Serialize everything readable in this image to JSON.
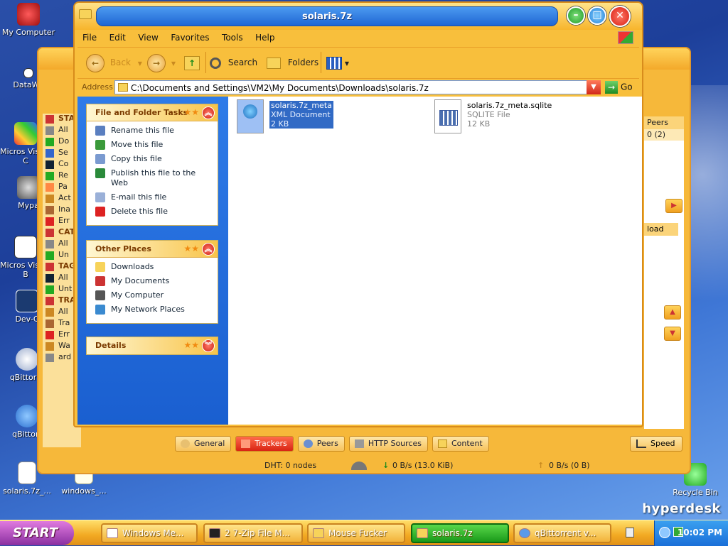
{
  "desktop": {
    "icons": [
      {
        "label": "My Computer"
      },
      {
        "label": "DataWa"
      },
      {
        "label": "Micros Visual C"
      },
      {
        "label": "Mypa"
      },
      {
        "label": "Micros Visual B"
      },
      {
        "label": "Dev-C"
      },
      {
        "label": "qBittorre"
      },
      {
        "label": "qBittorr"
      },
      {
        "label": "solaris.7z_..."
      },
      {
        "label": "windows_..."
      },
      {
        "label": "Recycle Bin"
      }
    ],
    "brand": "hyperdesk"
  },
  "qbittorrent": {
    "sidebar": [
      {
        "text": "STAT",
        "header": true
      },
      {
        "text": "All"
      },
      {
        "text": "Do"
      },
      {
        "text": "Se"
      },
      {
        "text": "Co"
      },
      {
        "text": "Re"
      },
      {
        "text": "Pa"
      },
      {
        "text": "Act"
      },
      {
        "text": "Ina"
      },
      {
        "text": "Err"
      },
      {
        "text": "CATE",
        "header": true
      },
      {
        "text": "All"
      },
      {
        "text": "Un"
      },
      {
        "text": "TAG",
        "header": true
      },
      {
        "text": "All"
      },
      {
        "text": "Unt"
      },
      {
        "text": "TRA",
        "header": true
      },
      {
        "text": "All"
      },
      {
        "text": "Tra"
      },
      {
        "text": "Err"
      },
      {
        "text": "Wa"
      },
      {
        "text": "ard"
      }
    ],
    "peers_header": "Peers",
    "peers_value": "0 (2)",
    "column_fragment": "load",
    "tabs": [
      {
        "label": "General"
      },
      {
        "label": "Trackers",
        "active": true
      },
      {
        "label": "Peers"
      },
      {
        "label": "HTTP Sources"
      },
      {
        "label": "Content"
      }
    ],
    "speed_button": "Speed",
    "status": {
      "dht": "DHT: 0 nodes",
      "down": "0 B/s (13.0 KiB)",
      "up": "0 B/s (0 B)"
    }
  },
  "explorer": {
    "title": "solaris.7z",
    "menu": [
      "File",
      "Edit",
      "View",
      "Favorites",
      "Tools",
      "Help"
    ],
    "toolbar": {
      "back": "Back",
      "search": "Search",
      "folders": "Folders"
    },
    "address": {
      "label": "Address",
      "path": "C:\\Documents and Settings\\VM2\\My Documents\\Downloads\\solaris.7z",
      "go": "Go"
    },
    "panels": {
      "tasks": {
        "title": "File and Folder Tasks",
        "items": [
          {
            "label": "Rename this file",
            "icon": "rename-icon"
          },
          {
            "label": "Move this file",
            "icon": "move-icon"
          },
          {
            "label": "Copy this file",
            "icon": "copy-icon"
          },
          {
            "label": "Publish this file to the Web",
            "icon": "publish-icon"
          },
          {
            "label": "E-mail this file",
            "icon": "email-icon"
          },
          {
            "label": "Delete this file",
            "icon": "delete-icon"
          }
        ]
      },
      "places": {
        "title": "Other Places",
        "items": [
          {
            "label": "Downloads",
            "icon": "folder-icon"
          },
          {
            "label": "My Documents",
            "icon": "documents-icon"
          },
          {
            "label": "My Computer",
            "icon": "computer-icon"
          },
          {
            "label": "My Network Places",
            "icon": "network-icon"
          }
        ]
      },
      "details": {
        "title": "Details"
      }
    },
    "files": [
      {
        "name": "solaris.7z_meta",
        "type": "XML Document",
        "size": "2 KB",
        "selected": true
      },
      {
        "name": "solaris.7z_meta.sqlite",
        "type": "SQLITE File",
        "size": "12 KB",
        "selected": false
      }
    ]
  },
  "taskbar": {
    "start": "START",
    "items": [
      {
        "label": "Windows Me..."
      },
      {
        "label": "2 7-Zip File M..."
      },
      {
        "label": "Mouse Fucker"
      },
      {
        "label": "solaris.7z",
        "active": true
      },
      {
        "label": "qBittorrent v..."
      }
    ],
    "clock": "10:02 PM"
  },
  "colors": {
    "window_orange": "#f8bf3c",
    "title_blue": "#1f66d4",
    "task_pane_blue": "#2e7be8",
    "selection_blue": "#316ac5"
  }
}
